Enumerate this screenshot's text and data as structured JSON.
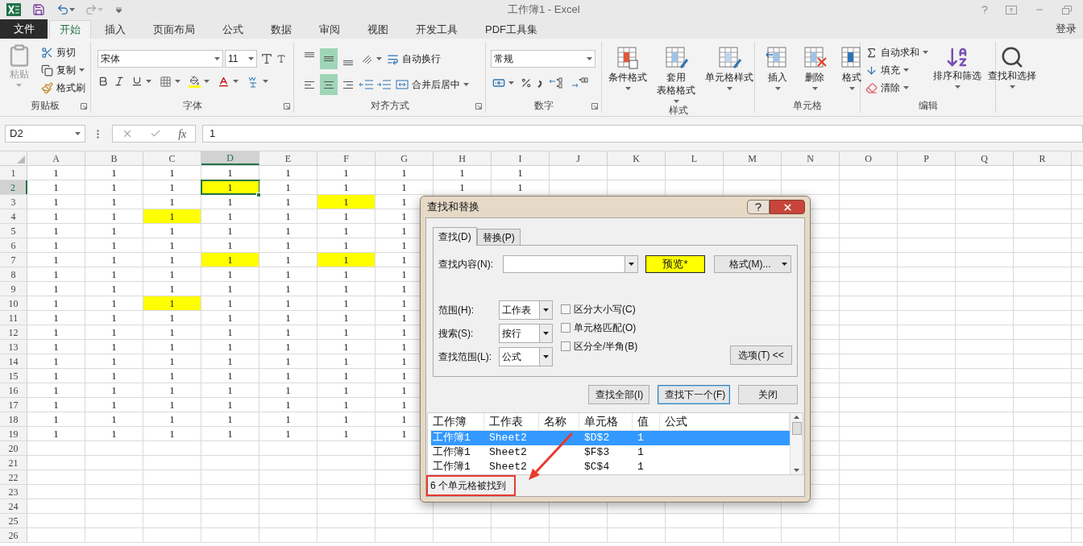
{
  "title_bar": {
    "title": "工作簿1 - Excel"
  },
  "ribbon_tabs": [
    {
      "label": "文件",
      "kind": "file",
      "selected": false
    },
    {
      "label": "开始",
      "kind": "tab",
      "selected": true
    },
    {
      "label": "插入",
      "kind": "tab",
      "selected": false
    },
    {
      "label": "页面布局",
      "kind": "tab",
      "selected": false
    },
    {
      "label": "公式",
      "kind": "tab",
      "selected": false
    },
    {
      "label": "数据",
      "kind": "tab",
      "selected": false
    },
    {
      "label": "审阅",
      "kind": "tab",
      "selected": false
    },
    {
      "label": "视图",
      "kind": "tab",
      "selected": false
    },
    {
      "label": "开发工具",
      "kind": "tab",
      "selected": false
    },
    {
      "label": "PDF工具集",
      "kind": "tab",
      "selected": false
    }
  ],
  "account": "登录",
  "ribbon": {
    "clipboard": {
      "label": "剪贴板",
      "paste": {
        "label": "粘贴",
        "disabled": true
      },
      "cut": "剪切",
      "copy": "复制",
      "format_painter": "格式刷"
    },
    "font": {
      "label": "字体",
      "font_name": "宋体",
      "font_size": "11"
    },
    "alignment": {
      "label": "对齐方式",
      "vertical": [
        {
          "selected": false
        },
        {
          "selected": true
        },
        {
          "selected": false
        }
      ],
      "horizontal": [
        {
          "selected": false
        },
        {
          "selected": true
        },
        {
          "selected": false
        }
      ],
      "wrap_text": "自动换行",
      "merge_center": "合并后居中"
    },
    "number": {
      "label": "数字",
      "format": "常规"
    },
    "styles": {
      "label": "样式",
      "buttons": [
        {
          "lines": [
            "条件格式"
          ]
        },
        {
          "lines": [
            "套用",
            "表格格式"
          ]
        },
        {
          "lines": [
            "单元格样式"
          ]
        }
      ]
    },
    "cells": {
      "label": "单元格",
      "buttons": [
        {
          "lines": [
            "插入"
          ]
        },
        {
          "lines": [
            "删除"
          ]
        },
        {
          "lines": [
            "格式"
          ]
        }
      ]
    },
    "editing": {
      "label": "编辑",
      "small": [
        "自动求和",
        "填充",
        "清除"
      ],
      "big": [
        {
          "lines": [
            "排序和筛选"
          ]
        },
        {
          "lines": [
            "查找和选择"
          ]
        }
      ]
    }
  },
  "formula_bar": {
    "name_box": "D2",
    "function_button": "fx",
    "value": "1"
  },
  "grid": {
    "columns": [
      {
        "label": "A",
        "selected": false
      },
      {
        "label": "B",
        "selected": false
      },
      {
        "label": "C",
        "selected": false
      },
      {
        "label": "D",
        "selected": true
      },
      {
        "label": "E",
        "selected": false
      },
      {
        "label": "F",
        "selected": false
      },
      {
        "label": "G",
        "selected": false
      },
      {
        "label": "H",
        "selected": false
      },
      {
        "label": "I",
        "selected": false
      },
      {
        "label": "J",
        "selected": false
      },
      {
        "label": "K",
        "selected": false
      },
      {
        "label": "L",
        "selected": false
      },
      {
        "label": "M",
        "selected": false
      },
      {
        "label": "N",
        "selected": false
      },
      {
        "label": "O",
        "selected": false
      },
      {
        "label": "P",
        "selected": false
      },
      {
        "label": "Q",
        "selected": false
      },
      {
        "label": "R",
        "selected": false
      }
    ],
    "rows": [
      {
        "label": "1",
        "selected": false,
        "cells": [
          {
            "text": "1",
            "highlighted": false
          },
          {
            "text": "1",
            "highlighted": false
          },
          {
            "text": "1",
            "highlighted": false
          },
          {
            "text": "1",
            "highlighted": false
          },
          {
            "text": "1",
            "highlighted": false
          },
          {
            "text": "1",
            "highlighted": false
          },
          {
            "text": "1",
            "highlighted": false
          },
          {
            "text": "1",
            "highlighted": false
          },
          {
            "text": "1",
            "highlighted": false
          }
        ]
      },
      {
        "label": "2",
        "selected": true,
        "cells": [
          {
            "text": "1",
            "highlighted": false
          },
          {
            "text": "1",
            "highlighted": false
          },
          {
            "text": "1",
            "highlighted": false
          },
          {
            "text": "1",
            "highlighted": true
          },
          {
            "text": "1",
            "highlighted": false
          },
          {
            "text": "1",
            "highlighted": false
          },
          {
            "text": "1",
            "highlighted": false
          },
          {
            "text": "1",
            "highlighted": false
          },
          {
            "text": "1",
            "highlighted": false
          }
        ]
      },
      {
        "label": "3",
        "selected": false,
        "cells": [
          {
            "text": "1",
            "highlighted": false
          },
          {
            "text": "1",
            "highlighted": false
          },
          {
            "text": "1",
            "highlighted": false
          },
          {
            "text": "1",
            "highlighted": false
          },
          {
            "text": "1",
            "highlighted": false
          },
          {
            "text": "1",
            "highlighted": true
          },
          {
            "text": "1",
            "highlighted": false
          }
        ]
      },
      {
        "label": "4",
        "selected": false,
        "cells": [
          {
            "text": "1",
            "highlighted": false
          },
          {
            "text": "1",
            "highlighted": false
          },
          {
            "text": "1",
            "highlighted": true
          },
          {
            "text": "1",
            "highlighted": false
          },
          {
            "text": "1",
            "highlighted": false
          },
          {
            "text": "1",
            "highlighted": false
          },
          {
            "text": "1",
            "highlighted": false
          }
        ]
      },
      {
        "label": "5",
        "selected": false,
        "cells": [
          {
            "text": "1",
            "highlighted": false
          },
          {
            "text": "1",
            "highlighted": false
          },
          {
            "text": "1",
            "highlighted": false
          },
          {
            "text": "1",
            "highlighted": false
          },
          {
            "text": "1",
            "highlighted": false
          },
          {
            "text": "1",
            "highlighted": false
          },
          {
            "text": "1",
            "highlighted": false
          }
        ]
      },
      {
        "label": "6",
        "selected": false,
        "cells": [
          {
            "text": "1",
            "highlighted": false
          },
          {
            "text": "1",
            "highlighted": false
          },
          {
            "text": "1",
            "highlighted": false
          },
          {
            "text": "1",
            "highlighted": false
          },
          {
            "text": "1",
            "highlighted": false
          },
          {
            "text": "1",
            "highlighted": false
          },
          {
            "text": "1",
            "highlighted": false
          }
        ]
      },
      {
        "label": "7",
        "selected": false,
        "cells": [
          {
            "text": "1",
            "highlighted": false
          },
          {
            "text": "1",
            "highlighted": false
          },
          {
            "text": "1",
            "highlighted": false
          },
          {
            "text": "1",
            "highlighted": true
          },
          {
            "text": "1",
            "highlighted": false
          },
          {
            "text": "1",
            "highlighted": true
          },
          {
            "text": "1",
            "highlighted": false
          }
        ]
      },
      {
        "label": "8",
        "selected": false,
        "cells": [
          {
            "text": "1",
            "highlighted": false
          },
          {
            "text": "1",
            "highlighted": false
          },
          {
            "text": "1",
            "highlighted": false
          },
          {
            "text": "1",
            "highlighted": false
          },
          {
            "text": "1",
            "highlighted": false
          },
          {
            "text": "1",
            "highlighted": false
          },
          {
            "text": "1",
            "highlighted": false
          }
        ]
      },
      {
        "label": "9",
        "selected": false,
        "cells": [
          {
            "text": "1",
            "highlighted": false
          },
          {
            "text": "1",
            "highlighted": false
          },
          {
            "text": "1",
            "highlighted": false
          },
          {
            "text": "1",
            "highlighted": false
          },
          {
            "text": "1",
            "highlighted": false
          },
          {
            "text": "1",
            "highlighted": false
          },
          {
            "text": "1",
            "highlighted": false
          }
        ]
      },
      {
        "label": "10",
        "selected": false,
        "cells": [
          {
            "text": "1",
            "highlighted": false
          },
          {
            "text": "1",
            "highlighted": false
          },
          {
            "text": "1",
            "highlighted": true
          },
          {
            "text": "1",
            "highlighted": false
          },
          {
            "text": "1",
            "highlighted": false
          },
          {
            "text": "1",
            "highlighted": false
          },
          {
            "text": "1",
            "highlighted": false
          }
        ]
      },
      {
        "label": "11",
        "selected": false,
        "cells": [
          {
            "text": "1",
            "highlighted": false
          },
          {
            "text": "1",
            "highlighted": false
          },
          {
            "text": "1",
            "highlighted": false
          },
          {
            "text": "1",
            "highlighted": false
          },
          {
            "text": "1",
            "highlighted": false
          },
          {
            "text": "1",
            "highlighted": false
          },
          {
            "text": "1",
            "highlighted": false
          }
        ]
      },
      {
        "label": "12",
        "selected": false,
        "cells": [
          {
            "text": "1",
            "highlighted": false
          },
          {
            "text": "1",
            "highlighted": false
          },
          {
            "text": "1",
            "highlighted": false
          },
          {
            "text": "1",
            "highlighted": false
          },
          {
            "text": "1",
            "highlighted": false
          },
          {
            "text": "1",
            "highlighted": false
          },
          {
            "text": "1",
            "highlighted": false
          }
        ]
      },
      {
        "label": "13",
        "selected": false,
        "cells": [
          {
            "text": "1",
            "highlighted": false
          },
          {
            "text": "1",
            "highlighted": false
          },
          {
            "text": "1",
            "highlighted": false
          },
          {
            "text": "1",
            "highlighted": false
          },
          {
            "text": "1",
            "highlighted": false
          },
          {
            "text": "1",
            "highlighted": false
          },
          {
            "text": "1",
            "highlighted": false
          }
        ]
      },
      {
        "label": "14",
        "selected": false,
        "cells": [
          {
            "text": "1",
            "highlighted": false
          },
          {
            "text": "1",
            "highlighted": false
          },
          {
            "text": "1",
            "highlighted": false
          },
          {
            "text": "1",
            "highlighted": false
          },
          {
            "text": "1",
            "highlighted": false
          },
          {
            "text": "1",
            "highlighted": false
          },
          {
            "text": "1",
            "highlighted": false
          }
        ]
      },
      {
        "label": "15",
        "selected": false,
        "cells": [
          {
            "text": "1",
            "highlighted": false
          },
          {
            "text": "1",
            "highlighted": false
          },
          {
            "text": "1",
            "highlighted": false
          },
          {
            "text": "1",
            "highlighted": false
          },
          {
            "text": "1",
            "highlighted": false
          },
          {
            "text": "1",
            "highlighted": false
          },
          {
            "text": "1",
            "highlighted": false
          }
        ]
      },
      {
        "label": "16",
        "selected": false,
        "cells": [
          {
            "text": "1",
            "highlighted": false
          },
          {
            "text": "1",
            "highlighted": false
          },
          {
            "text": "1",
            "highlighted": false
          },
          {
            "text": "1",
            "highlighted": false
          },
          {
            "text": "1",
            "highlighted": false
          },
          {
            "text": "1",
            "highlighted": false
          },
          {
            "text": "1",
            "highlighted": false
          }
        ]
      },
      {
        "label": "17",
        "selected": false,
        "cells": [
          {
            "text": "1",
            "highlighted": false
          },
          {
            "text": "1",
            "highlighted": false
          },
          {
            "text": "1",
            "highlighted": false
          },
          {
            "text": "1",
            "highlighted": false
          },
          {
            "text": "1",
            "highlighted": false
          },
          {
            "text": "1",
            "highlighted": false
          },
          {
            "text": "1",
            "highlighted": false
          }
        ]
      },
      {
        "label": "18",
        "selected": false,
        "cells": [
          {
            "text": "1",
            "highlighted": false
          },
          {
            "text": "1",
            "highlighted": false
          },
          {
            "text": "1",
            "highlighted": false
          },
          {
            "text": "1",
            "highlighted": false
          },
          {
            "text": "1",
            "highlighted": false
          },
          {
            "text": "1",
            "highlighted": false
          },
          {
            "text": "1",
            "highlighted": false
          }
        ]
      },
      {
        "label": "19",
        "selected": false,
        "cells": [
          {
            "text": "1",
            "highlighted": false
          },
          {
            "text": "1",
            "highlighted": false
          },
          {
            "text": "1",
            "highlighted": false
          },
          {
            "text": "1",
            "highlighted": false
          },
          {
            "text": "1",
            "highlighted": false
          },
          {
            "text": "1",
            "highlighted": false
          },
          {
            "text": "1",
            "highlighted": false
          }
        ]
      },
      {
        "label": "20",
        "selected": false
      },
      {
        "label": "21",
        "selected": false
      },
      {
        "label": "22",
        "selected": false
      },
      {
        "label": "23",
        "selected": false
      },
      {
        "label": "24",
        "selected": false
      },
      {
        "label": "25",
        "selected": false
      },
      {
        "label": "26",
        "selected": false
      }
    ]
  },
  "dialog": {
    "title": "查找和替换",
    "tabs": [
      {
        "label": "查找(D)",
        "selected": true
      },
      {
        "label": "替换(P)",
        "selected": false
      }
    ],
    "find_label": "查找内容(N):",
    "preview": "预览*",
    "format_button": "格式(M)...",
    "options": [
      {
        "label": "范围(H):",
        "value": "工作表"
      },
      {
        "label": "搜索(S):",
        "value": "按行"
      },
      {
        "label": "查找范围(L):",
        "value": "公式"
      }
    ],
    "checkboxes": [
      {
        "label": "区分大小写(C)",
        "checked": false
      },
      {
        "label": "单元格匹配(O)",
        "checked": false
      },
      {
        "label": "区分全/半角(B)",
        "checked": false
      }
    ],
    "options_button": "选项(T) <<",
    "buttons": [
      {
        "label": "查找全部(I)",
        "focused": false
      },
      {
        "label": "查找下一个(F)",
        "focused": true
      },
      {
        "label": "关闭",
        "focused": false
      }
    ],
    "results": {
      "columns": [
        "工作簿",
        "工作表",
        "名称",
        "单元格",
        "值",
        "公式"
      ],
      "rows": [
        {
          "cells": [
            "工作簿1",
            "Sheet2",
            "",
            "$D$2",
            "1"
          ],
          "selected": true
        },
        {
          "cells": [
            "工作簿1",
            "Sheet2",
            "",
            "$F$3",
            "1"
          ],
          "selected": false
        },
        {
          "cells": [
            "工作簿1",
            "Sheet2",
            "",
            "$C$4",
            "1"
          ],
          "selected": false
        }
      ]
    },
    "status": "6 个单元格被找到"
  }
}
